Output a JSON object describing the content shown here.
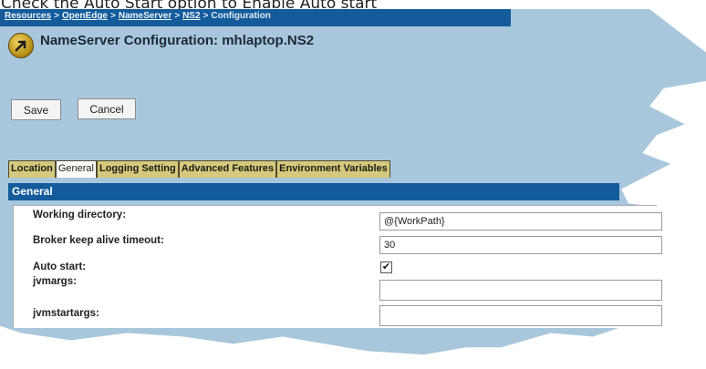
{
  "caption": "Check the Auto Start option to Enable Auto start",
  "breadcrumb": {
    "items": [
      "Resources",
      "OpenEdge",
      "NameServer",
      "NS2",
      "Configuration"
    ],
    "separator": ">"
  },
  "header": {
    "title": "NameServer Configuration: mhlaptop.NS2",
    "icon": "arrow-up-right-icon"
  },
  "toolbar": {
    "save_label": "Save",
    "cancel_label": "Cancel"
  },
  "tabs": [
    {
      "label": "Location",
      "active": false
    },
    {
      "label": "General",
      "active": true
    },
    {
      "label": "Logging Setting",
      "active": false
    },
    {
      "label": "Advanced Features",
      "active": false
    },
    {
      "label": "Environment Variables",
      "active": false
    }
  ],
  "section": {
    "title": "General"
  },
  "fields": {
    "working_directory": {
      "label": "Working directory:",
      "value": "@{WorkPath}"
    },
    "keep_alive": {
      "label": "Broker keep alive timeout:",
      "value": "30"
    },
    "auto_start": {
      "label": "Auto start:",
      "checked": true,
      "mark": "✔"
    },
    "jvmargs": {
      "label": "jvmargs:",
      "value": ""
    },
    "jvmstartargs": {
      "label": "jvmstartargs:",
      "value": ""
    }
  },
  "colors": {
    "panel": "#a9c7dc",
    "bar": "#135b9a",
    "tab": "#d6c97d"
  }
}
